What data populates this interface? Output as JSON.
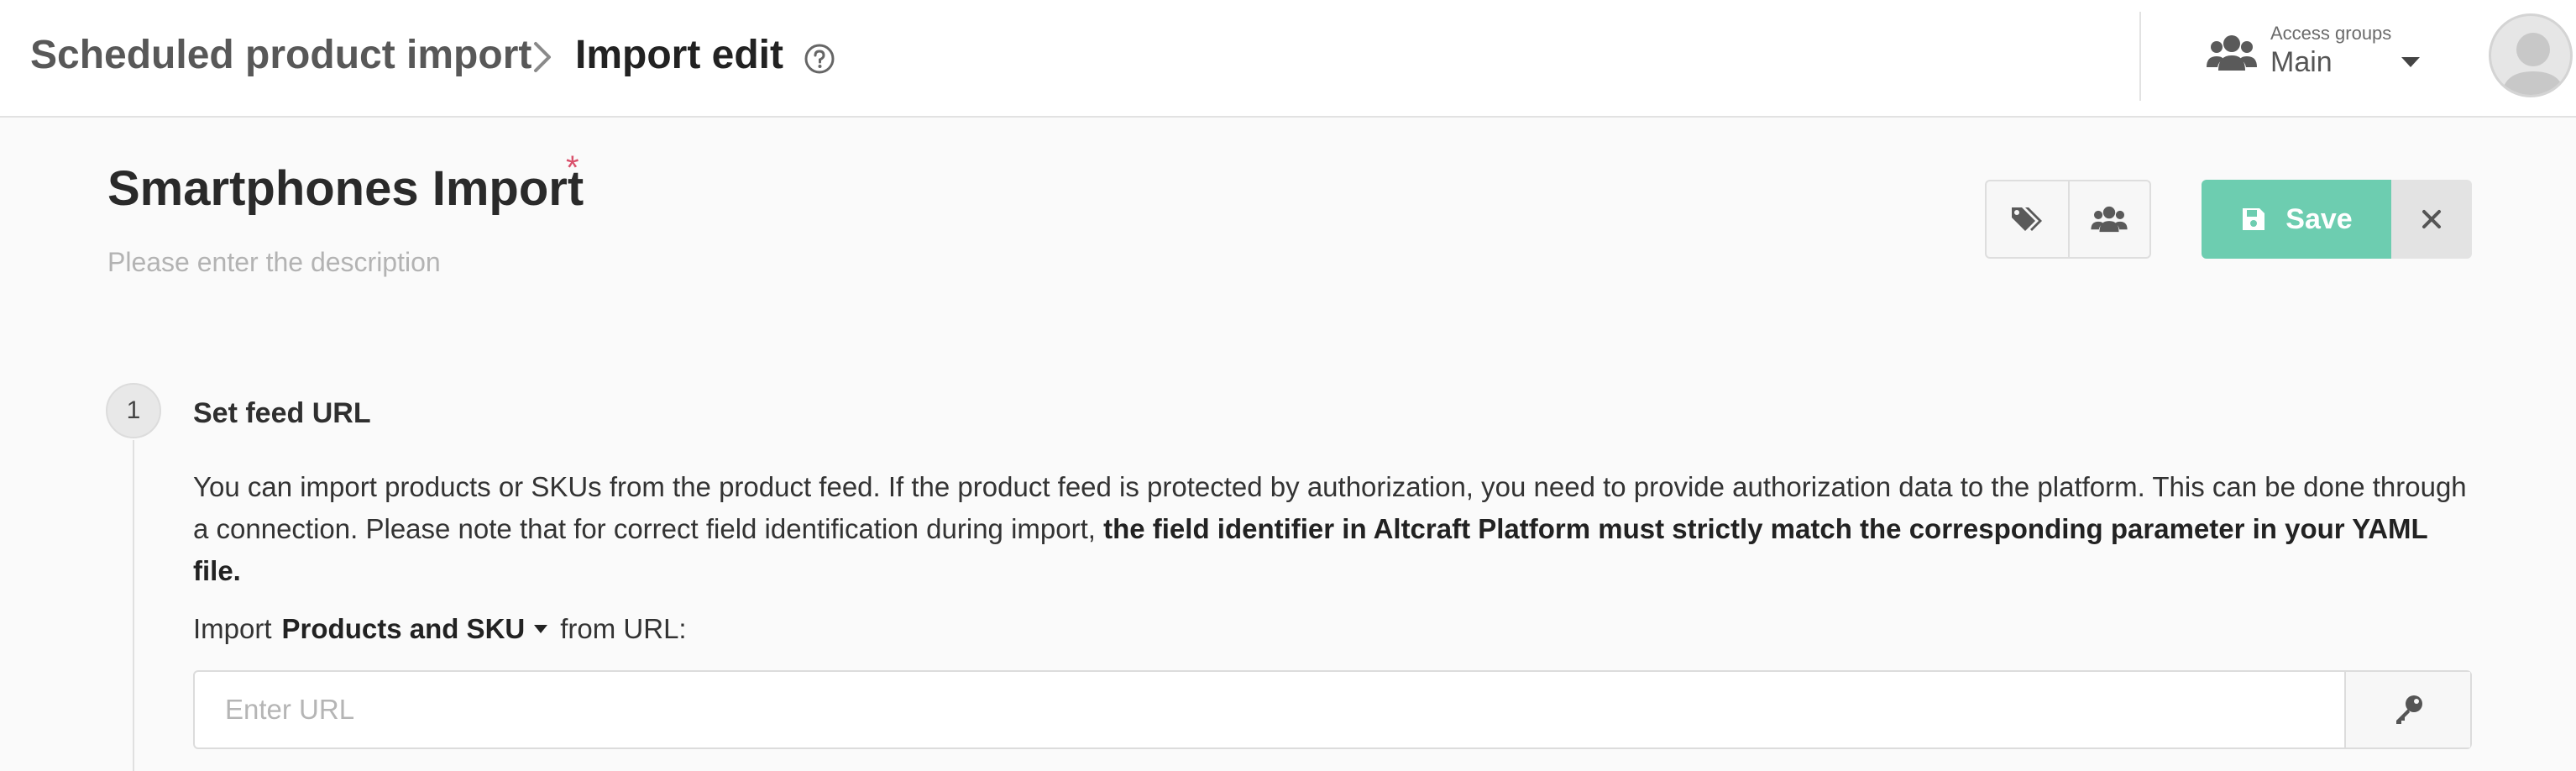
{
  "header": {
    "breadcrumb_parent": "Scheduled product import",
    "breadcrumb_current": "Import edit",
    "access_groups_label": "Access groups",
    "access_groups_value": "Main"
  },
  "page": {
    "title": "Smartphones Import",
    "required_mark": "*",
    "description_placeholder": "Please enter the description"
  },
  "toolbar": {
    "tags_icon": "tags-icon",
    "groups_icon": "users-icon",
    "save_label": "Save",
    "save_icon": "floppy-disk-icon",
    "close_icon": "close-icon"
  },
  "step1": {
    "number": "1",
    "title": "Set feed URL",
    "description_plain": "You can import products or SKUs from the product feed. If the product feed is protected by authorization, you need to provide authorization data to the platform. This can be done through a connection. Please note that for correct field identification during import, ",
    "description_bold": "the field identifier in Altcraft Platform must strictly match the corresponding parameter in your YAML file.",
    "import_prefix": "Import",
    "import_type": "Products and SKU",
    "import_suffix": "from URL:",
    "url_value": "",
    "url_placeholder": "Enter URL",
    "url_key_icon": "key-icon"
  },
  "colors": {
    "accent_save": "#6dcdb0",
    "required": "#d9506b",
    "background": "#fafafa"
  }
}
